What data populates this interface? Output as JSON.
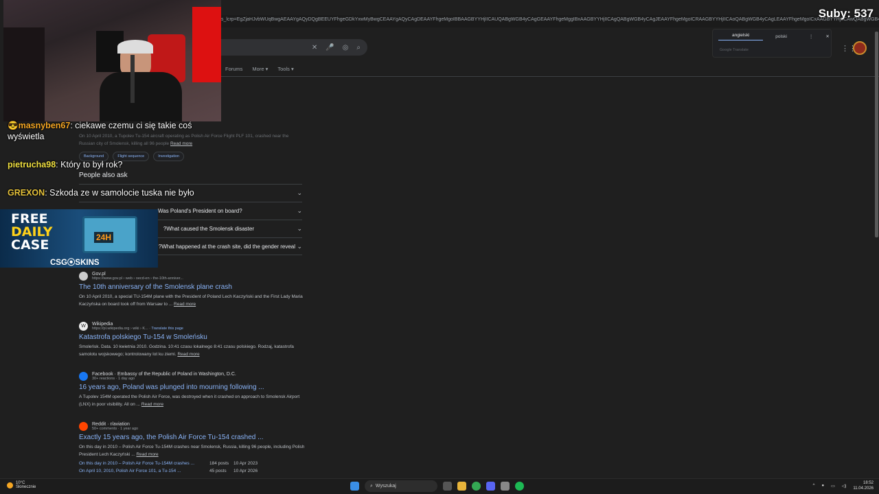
{
  "browser": {
    "url": "s_lcrp=EgZjaHJvbWUqBwgAEAAYgAQyDQgBEEUYFhgeGDkYxwMyBwgCEAAYgAQyCAgDEAAYFhgeMgoIBBAAGBYYHjIICAUQABgWGB4yCAgGEAAYFhgeMggIBxAAGBYYHjIICAgQABgWGB4yCAgJEAAYFhgeMgoICRAAGBYYHjIICAoQABgWGB4yCAgLEAAYFhgeMgoICxAAGBYYHjIICAwQABgWGB4yCAgNEAAYFhgeOgEIMzQxMmowajeoAgCwAgA&sourceid=chrome&ie",
    "filters": [
      "Forums",
      "More ▾",
      "Tools ▾"
    ],
    "translate": {
      "tab_active": "angielski",
      "tab_other": "polski",
      "footer": "Google Translate"
    }
  },
  "stream": {
    "subs": "Suby: 537",
    "chat": [
      {
        "user": "masnyben67",
        "msg": " ciekawe czemu ci się takie coś wyświetla"
      },
      {
        "user": "pietrucha98",
        "msg": " Który to był rok?"
      },
      {
        "user": "GREXON",
        "msg": " Szkoda ze w samolocie tuska nie było"
      }
    ],
    "ad": {
      "line1": "FREE",
      "line2": "DAILY",
      "line3": "CASE",
      "box_label": "24H",
      "brand": "CSG⦿SKINS"
    }
  },
  "results": {
    "featured_snippet": "On 10 April 2010, a Tupolev Tu-154 aircraft operating as Polish Air Force Flight PLF 101, crashed near the Russian city of Smolensk, killing all 96 people",
    "featured_readmore": "Read more",
    "chips": [
      "Background",
      "Flight sequence",
      "Investigation"
    ],
    "paa_title": "People also ask",
    "paa": [
      "",
      "Was Poland's President on board?",
      "What caused the Smolensk disaster?",
      "What happened at the crash site, did the gender reveal?"
    ],
    "items": [
      {
        "site": "Gov.pl",
        "url": "https://www.gov.pl › web › oecd-en › the-10th-anniver...",
        "title": "The 10th anniversary of the Smolensk plane crash",
        "snippet": "On 10 April 2010, a special TU-154M plane with the President of Poland Lech Kaczyński and the First Lady Maria Kaczyńska on board took off from Warsaw to ...",
        "more": "Read more"
      },
      {
        "site": "Wikipedia",
        "url": "https://pl.wikipedia.org › wiki › K...",
        "translate": "Translate this page",
        "title": "Katastrofa polskiego Tu-154 w Smoleńsku",
        "snippet": "Smoleńsk. Data. 10 kwietnia 2010. Godzina. 10:41 czasu lokalnego 8:41 czasu polskiego. Rodzaj, katastrofa samolotu wojskowego; kontrolowany lot ku ziemi.",
        "more": "Read more"
      },
      {
        "site": "Facebook · Embassy of the Republic of Poland in Washington, D.C.",
        "url": "30+ reactions · 1 day ago",
        "title": "16 years ago, Poland was plunged into mourning following ...",
        "snippet": "A Tupolev 154M operated the Polish Air Force, was destroyed when it crashed on approach to Smolensk Airport (LNX) in poor visibility. All on ...",
        "more": "Read more"
      },
      {
        "site": "Reddit · r/aviation",
        "url": "50+ comments · 1 year ago",
        "title": "Exactly 15 years ago, the Polish Air Force Tu-154 crashed ...",
        "snippet": "On this day in 2010 – Polish Air Force Tu-154M crashes near Smolensk, Russia, killing 96 people, including Polish President Lech Kaczyński ...",
        "more": "Read more"
      }
    ],
    "reddit_sub": [
      {
        "text": "On this day in 2010 – Polish Air Force Tu-154M crashes ...",
        "posts": "184 posts",
        "date": "10 Apr 2023"
      },
      {
        "text": "On April 10, 2010, Polish Air Force 101, a Tu-154 ...",
        "posts": "45 posts",
        "date": "10 Apr 2026"
      }
    ]
  },
  "taskbar": {
    "temp": "10°C",
    "weather": "Słonecznie",
    "search": "Wyszukaj",
    "time": "18:52",
    "date": "11.04.2026"
  }
}
